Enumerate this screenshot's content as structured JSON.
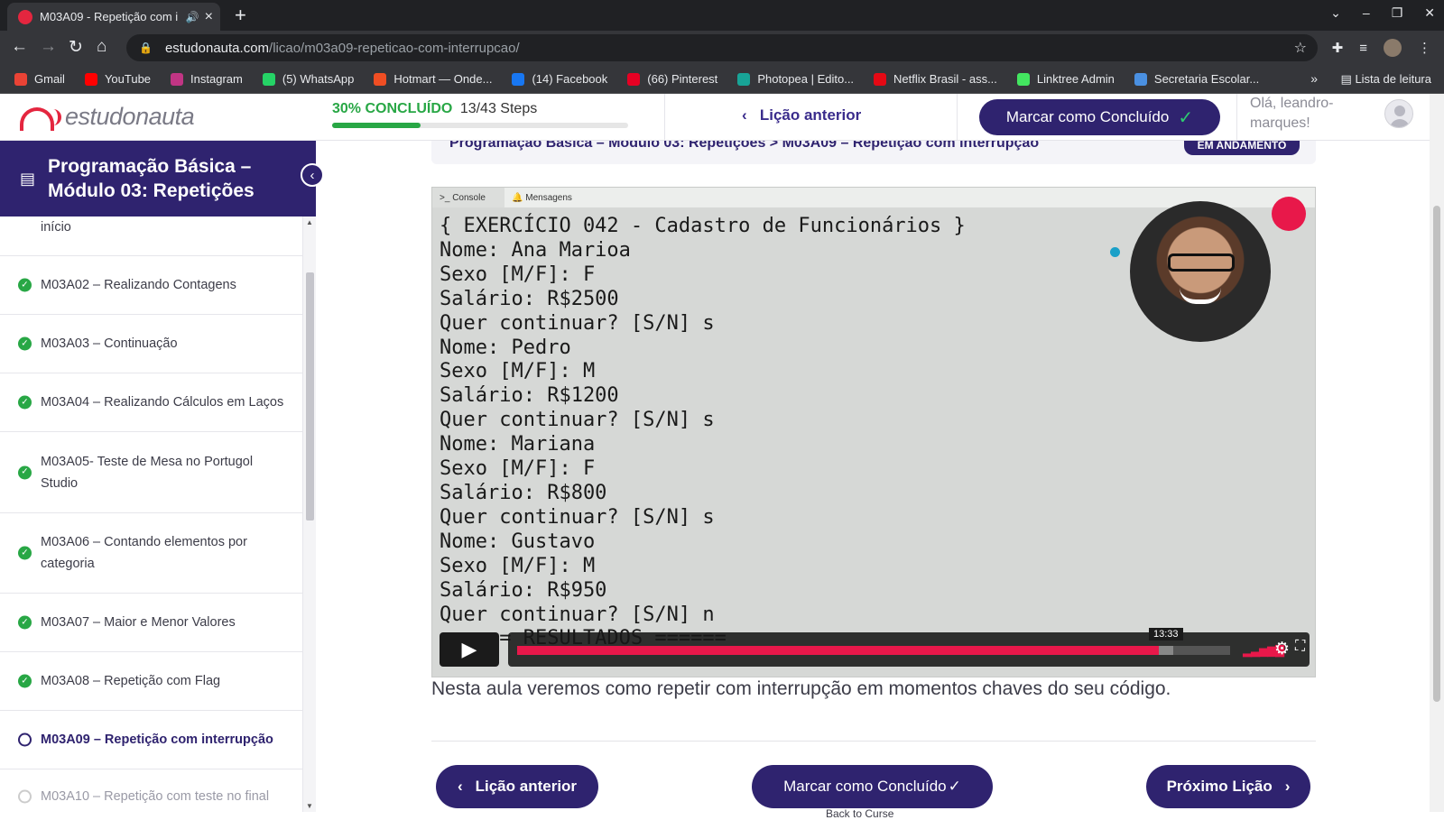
{
  "browser": {
    "tab_title": "M03A09 - Repetição com i",
    "url_host": "estudonauta.com",
    "url_path": "/licao/m03a09-repeticao-com-interrupcao/",
    "bookmarks": [
      {
        "label": "Gmail",
        "color": "#ea4335"
      },
      {
        "label": "YouTube",
        "color": "#ff0000"
      },
      {
        "label": "Instagram",
        "color": "#c13584"
      },
      {
        "label": "(5) WhatsApp",
        "color": "#25d366"
      },
      {
        "label": "Hotmart — Onde...",
        "color": "#f04e23"
      },
      {
        "label": "(14) Facebook",
        "color": "#1877f2"
      },
      {
        "label": "(66) Pinterest",
        "color": "#e60023"
      },
      {
        "label": "Photopea | Edito...",
        "color": "#18a497"
      },
      {
        "label": "Netflix Brasil - ass...",
        "color": "#e50914"
      },
      {
        "label": "Linktree Admin",
        "color": "#43e660"
      },
      {
        "label": "Secretaria Escolar...",
        "color": "#4a90e2"
      }
    ],
    "reading_list": "Lista de leitura"
  },
  "header": {
    "logo": "estudonauta",
    "progress_pct": "30% CONCLUÍDO",
    "progress_steps": "13/43 Steps",
    "progress_value": 0.3,
    "prev_lesson": "Lição anterior",
    "mark_complete": "Marcar como Concluído",
    "greeting": "Olá, leandro-marques!"
  },
  "sidebar": {
    "title": "Programação Básica – Módulo 03: Repetições",
    "items": [
      {
        "label": "início",
        "status": "none"
      },
      {
        "label": "M03A02 – Realizando Contagens",
        "status": "done"
      },
      {
        "label": "M03A03 – Continuação",
        "status": "done"
      },
      {
        "label": "M03A04 – Realizando Cálculos em Laços",
        "status": "done"
      },
      {
        "label": "M03A05- Teste de Mesa no Portugol Studio",
        "status": "done"
      },
      {
        "label": "M03A06 – Contando elementos por categoria",
        "status": "done"
      },
      {
        "label": "M03A07 – Maior e Menor Valores",
        "status": "done"
      },
      {
        "label": "M03A08 – Repetição com Flag",
        "status": "done"
      },
      {
        "label": "M03A09 – Repetição com interrupção",
        "status": "current"
      },
      {
        "label": "M03A10 – Repetição com teste no final",
        "status": "todo"
      }
    ]
  },
  "main": {
    "breadcrumb": "Programação Básica – Módulo 03: Repetições > M03A09 – Repetição com interrupção",
    "status_badge": "EM ANDAMENTO",
    "player": {
      "tab_console": "Console",
      "tab_messages": "Mensagens",
      "console_lines": [
        "{ EXERCÍCIO 042 - Cadastro de Funcionários }",
        "Nome: Ana Marioa",
        "Sexo [M/F]: F",
        "Salário: R$2500",
        "Quer continuar? [S/N] s",
        "Nome: Pedro",
        "Sexo [M/F]: M",
        "Salário: R$1200",
        "Quer continuar? [S/N] s",
        "Nome: Mariana",
        "Sexo [M/F]: F",
        "Salário: R$800",
        "Quer continuar? [S/N] s",
        "Nome: Gustavo",
        "Sexo [M/F]: M",
        "Salário: R$950",
        "Quer continuar? [S/N] n",
        "====== RESULTADOS ======"
      ],
      "time_tooltip": "13:33",
      "played_fraction": 0.9
    },
    "lesson_text": "Nesta aula veremos como repetir com interrupção em momentos chaves do seu código.",
    "footer": {
      "prev": "Lição anterior",
      "mark": "Marcar como Concluído",
      "next": "Próximo Lição",
      "back": "Back to Curse"
    }
  }
}
